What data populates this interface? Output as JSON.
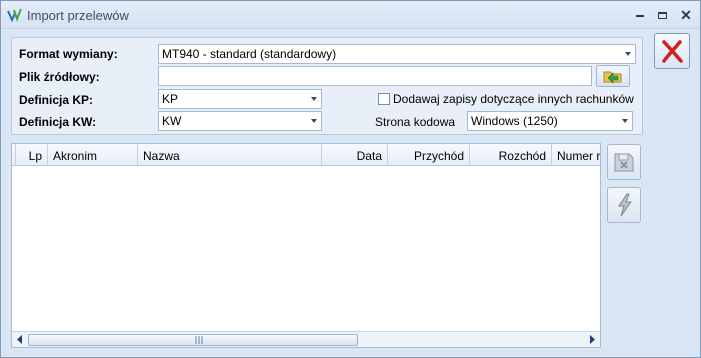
{
  "window": {
    "title": "Import przelewów"
  },
  "form": {
    "format_label": "Format wymiany:",
    "format_value": "MT940 - standard (standardowy)",
    "source_file_label": "Plik źródłowy:",
    "source_file_value": "",
    "def_kp_label": "Definicja KP:",
    "def_kp_value": "KP",
    "def_kw_label": "Definicja KW:",
    "def_kw_value": "KW",
    "other_accounts_label": "Dodawaj zapisy dotyczące innych rachunków",
    "other_accounts_checked": false,
    "codepage_label": "Strona kodowa",
    "codepage_value": "Windows (1250)"
  },
  "grid": {
    "columns": [
      "Lp",
      "Akronim",
      "Nazwa",
      "Data",
      "Przychód",
      "Rozchód",
      "Numer ra"
    ],
    "rows": []
  },
  "colors": {
    "window_bg": "#dbe6f4",
    "panel_bg": "#e9eff8",
    "close_x": "#d21f1f"
  }
}
